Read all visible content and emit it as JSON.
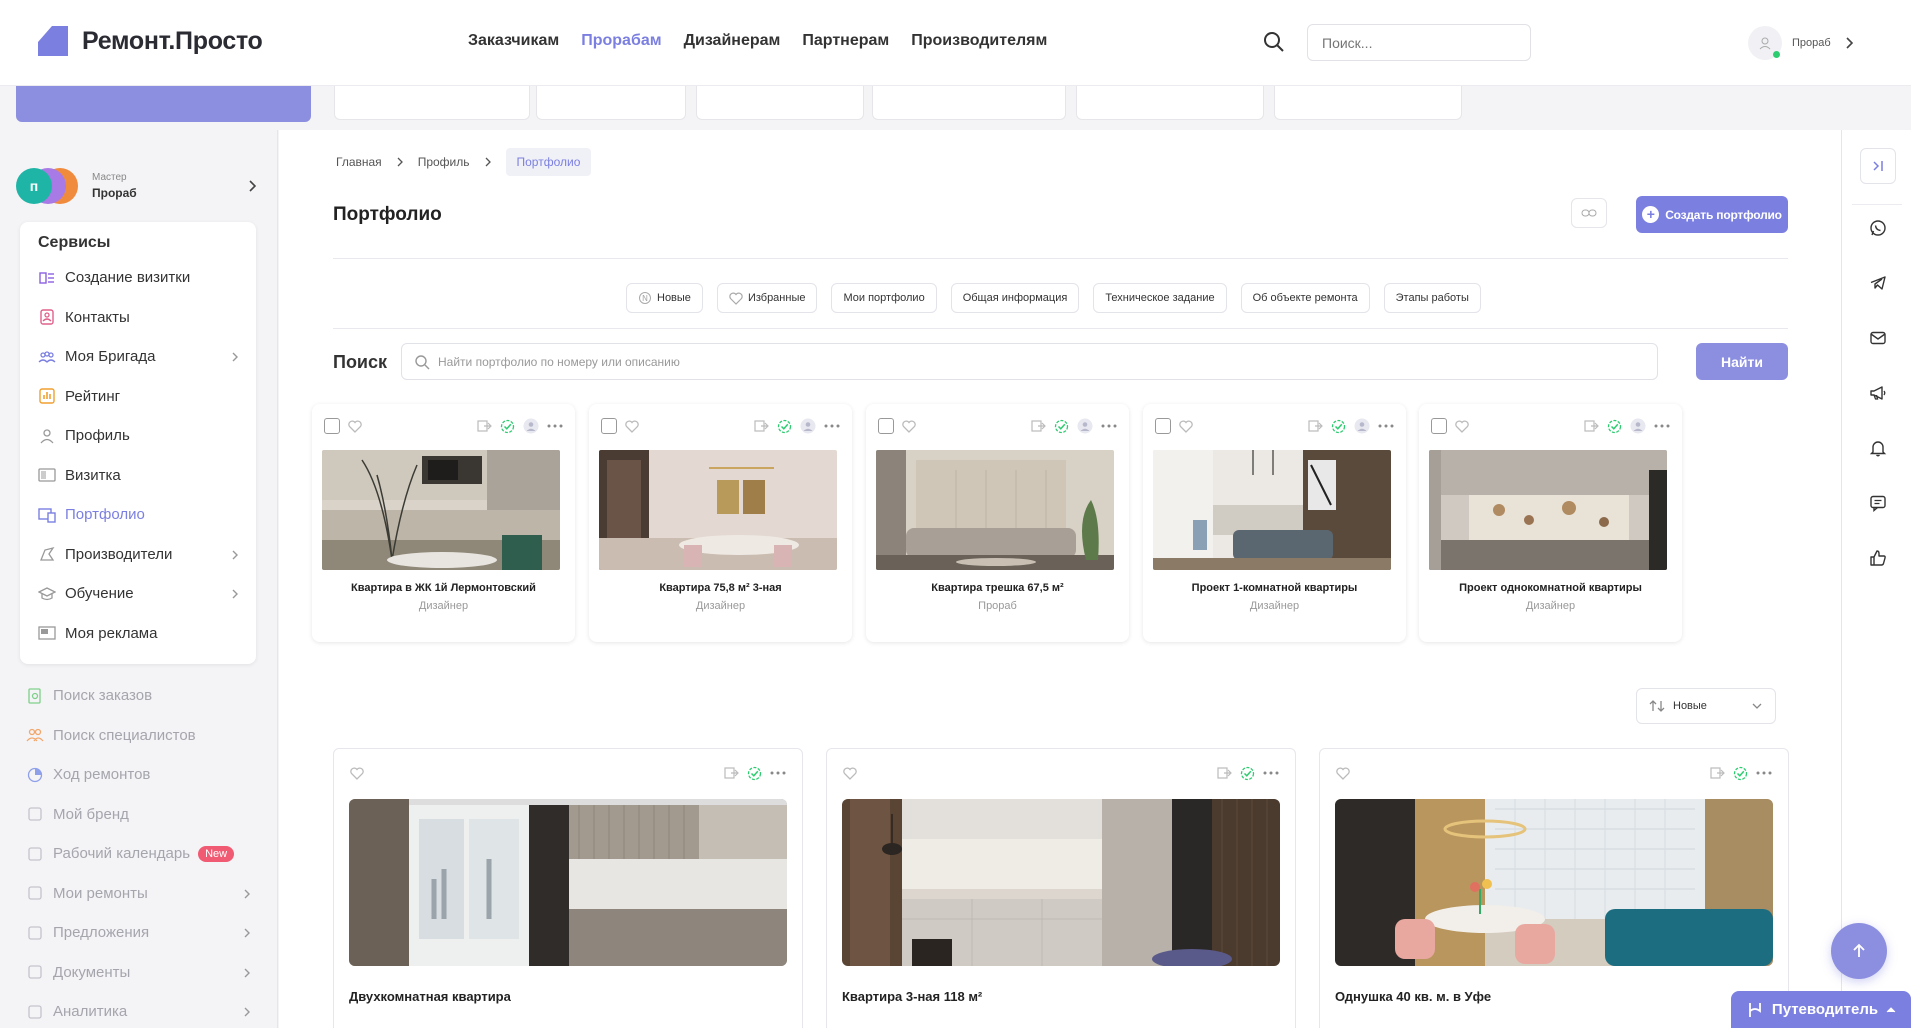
{
  "header": {
    "logo_text": "Ремонт.Просто",
    "nav": [
      "Заказчикам",
      "Прорабам",
      "Дизайнерам",
      "Партнерам",
      "Производителям"
    ],
    "active_nav": "Прорабам",
    "search_placeholder": "Поиск...",
    "user_role": "Прораб"
  },
  "sidebar": {
    "role_label": "Мастер",
    "role_name": "Прораб",
    "avatar_initial": "п",
    "services_title": "Сервисы",
    "services": [
      {
        "label": "Создание визитки",
        "icon": "card-create-icon",
        "active": false,
        "chevron": false
      },
      {
        "label": "Контакты",
        "icon": "contacts-icon",
        "active": false,
        "chevron": false
      },
      {
        "label": "Моя Бригада",
        "icon": "team-icon",
        "active": false,
        "chevron": true
      },
      {
        "label": "Рейтинг",
        "icon": "rating-icon",
        "active": false,
        "chevron": false
      },
      {
        "label": "Профиль",
        "icon": "profile-icon",
        "active": false,
        "chevron": false
      },
      {
        "label": "Визитка",
        "icon": "business-card-icon",
        "active": false,
        "chevron": false
      },
      {
        "label": "Портфолио",
        "icon": "portfolio-icon",
        "active": true,
        "chevron": false
      },
      {
        "label": "Производители",
        "icon": "manufacturers-icon",
        "active": false,
        "chevron": true
      },
      {
        "label": "Обучение",
        "icon": "education-icon",
        "active": false,
        "chevron": true
      },
      {
        "label": "Моя реклама",
        "icon": "ads-icon",
        "active": false,
        "chevron": false
      }
    ],
    "more": [
      {
        "label": "Поиск заказов",
        "icon": "order-search-icon",
        "chevron": false,
        "badge": ""
      },
      {
        "label": "Поиск специалистов",
        "icon": "specialists-icon",
        "chevron": false,
        "badge": ""
      },
      {
        "label": "Ход ремонтов",
        "icon": "progress-icon",
        "chevron": false,
        "badge": ""
      },
      {
        "label": "Мой бренд",
        "icon": "brand-icon",
        "chevron": false,
        "badge": ""
      },
      {
        "label": "Рабочий календарь",
        "icon": "calendar-icon",
        "chevron": false,
        "badge": "New"
      },
      {
        "label": "Мои ремонты",
        "icon": "repairs-icon",
        "chevron": true,
        "badge": ""
      },
      {
        "label": "Предложения",
        "icon": "offers-icon",
        "chevron": true,
        "badge": ""
      },
      {
        "label": "Документы",
        "icon": "documents-icon",
        "chevron": true,
        "badge": ""
      },
      {
        "label": "Аналитика",
        "icon": "analytics-icon",
        "chevron": true,
        "badge": ""
      }
    ]
  },
  "main": {
    "breadcrumb": [
      "Главная",
      "Профиль",
      "Портфолио"
    ],
    "title": "Портфолио",
    "create_label": "Создать портфолио",
    "filters": [
      "Новые",
      "Избранные",
      "Мои портфолио",
      "Общая информация",
      "Техническое задание",
      "Об объекте ремонта",
      "Этапы работы"
    ],
    "search_label": "Поиск",
    "search_placeholder": "Найти портфолио по номеру или описанию",
    "find_label": "Найти",
    "sort_label": "Новые",
    "small_cards": [
      {
        "title": "Квартира в ЖК 1й Лермонтовский",
        "role": "Дизайнер"
      },
      {
        "title": "Квартира 75,8 м² 3-ная",
        "role": "Дизайнер"
      },
      {
        "title": "Квартира трешка 67,5 м²",
        "role": "Прораб"
      },
      {
        "title": "Проект 1-комнатной квартиры",
        "role": "Дизайнер"
      },
      {
        "title": "Проект однокомнатной квартиры",
        "role": "Дизайнер"
      }
    ],
    "big_cards": [
      {
        "title": "Двухкомнатная квартира"
      },
      {
        "title": "Квартира 3-ная 118 м²"
      },
      {
        "title": "Однушка 40 кв. м. в Уфе"
      }
    ]
  },
  "rail": [
    "whatsapp-icon",
    "telegram-icon",
    "mail-icon",
    "megaphone-icon",
    "bell-icon",
    "chat-icon",
    "thumbs-up-icon"
  ],
  "guide_label": "Путеводитель",
  "colors": {
    "accent": "#7b7fe0",
    "green": "#2ecc71",
    "badge": "#f05b73"
  }
}
